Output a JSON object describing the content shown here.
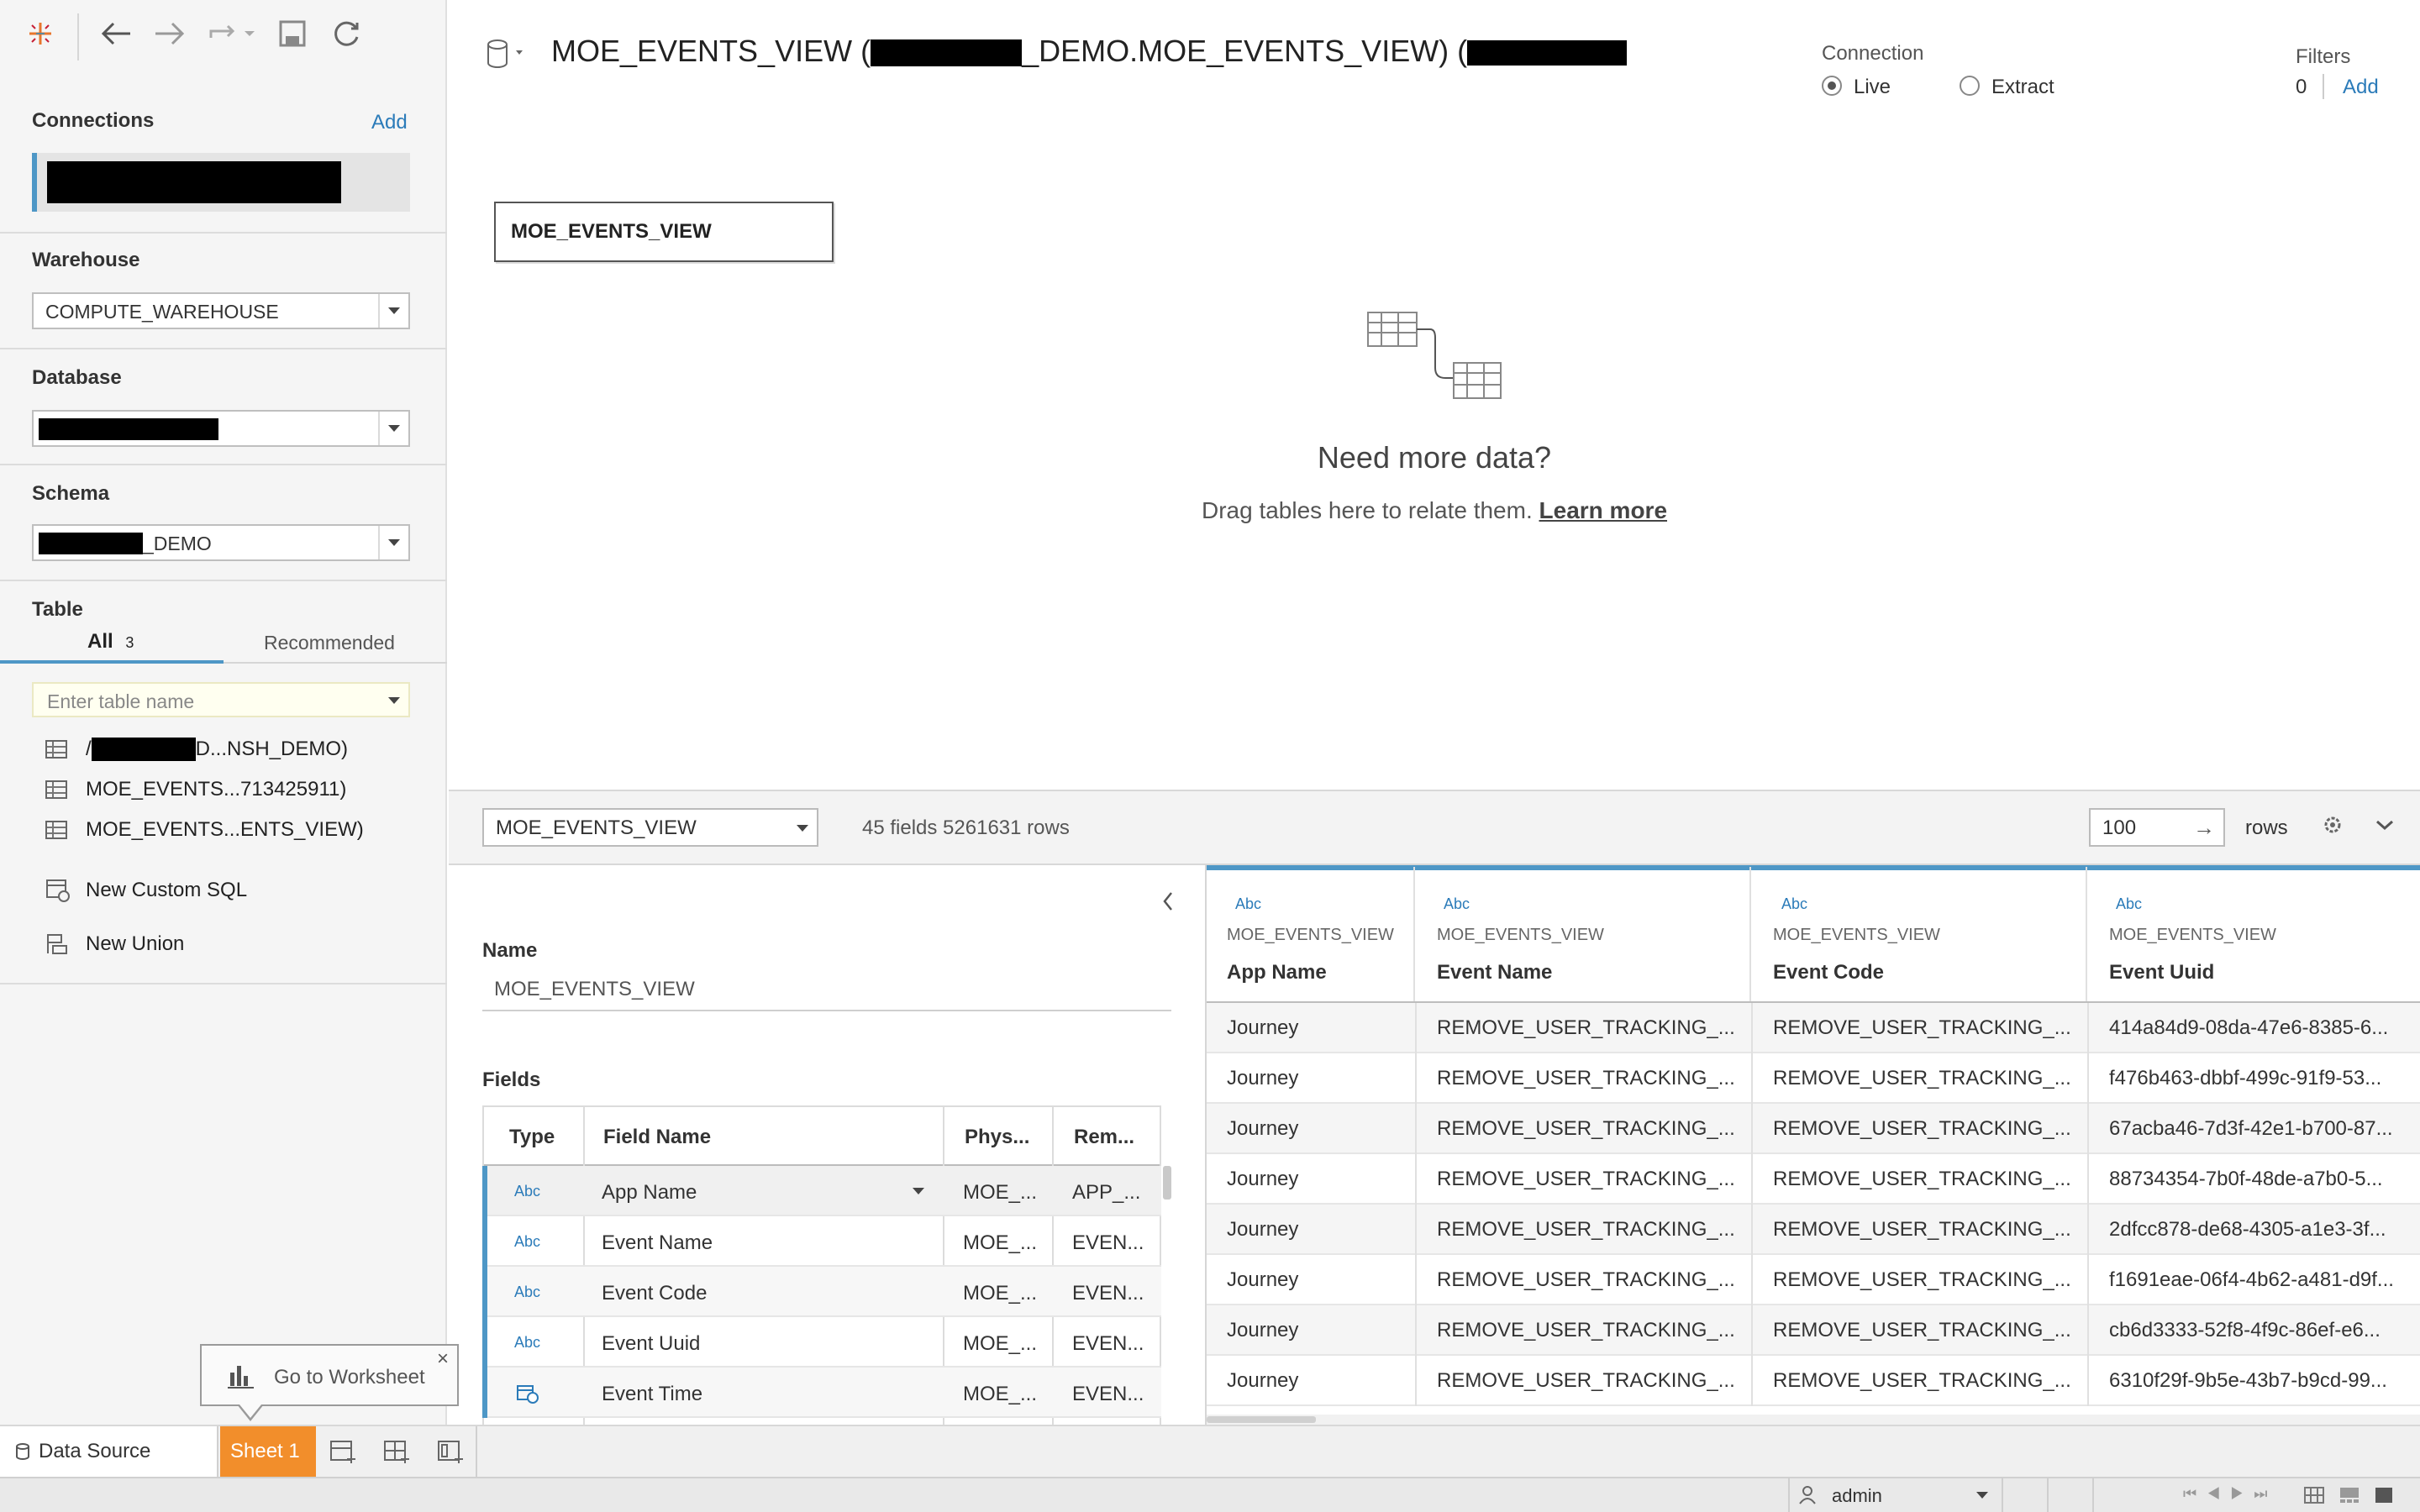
{
  "toolbar": {
    "icons": [
      "tableau-logo-icon",
      "back-arrow-icon",
      "forward-arrow-icon",
      "redo-icon",
      "save-icon",
      "refresh-icon"
    ]
  },
  "sidebar": {
    "connections": {
      "heading": "Connections",
      "add_label": "Add"
    },
    "warehouse": {
      "heading": "Warehouse",
      "value": "COMPUTE_WAREHOUSE"
    },
    "database": {
      "heading": "Database"
    },
    "schema": {
      "heading": "Schema",
      "value_suffix": "_DEMO"
    },
    "table": {
      "heading": "Table",
      "tab_all": "All",
      "tab_all_count": "3",
      "tab_recommended": "Recommended",
      "search_placeholder": "Enter table name",
      "items": [
        {
          "label": "D...NSH_DEMO)",
          "prefix": "/"
        },
        {
          "label": "MOE_EVENTS...713425911)"
        },
        {
          "label": "MOE_EVENTS...ENTS_VIEW)"
        }
      ],
      "new_custom_sql": "New Custom SQL",
      "new_union": "New Union"
    }
  },
  "canvas": {
    "title_part1": "MOE_EVENTS_VIEW (",
    "title_part2": "_DEMO.MOE_EVENTS_VIEW) (",
    "connection": {
      "label": "Connection",
      "live": "Live",
      "extract": "Extract",
      "selected": "Live"
    },
    "filters": {
      "label": "Filters",
      "count": "0",
      "add": "Add"
    },
    "table_box": "MOE_EVENTS_VIEW",
    "empty_title": "Need more data?",
    "empty_text": "Drag tables here to relate them.",
    "learn_more": "Learn more"
  },
  "data_toolbar": {
    "table_select": "MOE_EVENTS_VIEW",
    "summary": "45 fields 5261631 rows",
    "rows_value": "100",
    "rows_label": "rows"
  },
  "metadata": {
    "name_label": "Name",
    "name_value": "MOE_EVENTS_VIEW",
    "fields_label": "Fields",
    "columns": [
      "Type",
      "Field Name",
      "Phys...",
      "Rem..."
    ],
    "rows": [
      {
        "type": "Abc",
        "field": "App Name",
        "phys": "MOE_...",
        "rem": "APP_..."
      },
      {
        "type": "Abc",
        "field": "Event Name",
        "phys": "MOE_...",
        "rem": "EVEN..."
      },
      {
        "type": "Abc",
        "field": "Event Code",
        "phys": "MOE_...",
        "rem": "EVEN..."
      },
      {
        "type": "Abc",
        "field": "Event Uuid",
        "phys": "MOE_...",
        "rem": "EVEN..."
      },
      {
        "type": "date",
        "field": "Event Time",
        "phys": "MOE_...",
        "rem": "EVEN..."
      }
    ]
  },
  "grid": {
    "columns": [
      {
        "type": "Abc",
        "source": "MOE_EVENTS_VIEW",
        "name": "App Name"
      },
      {
        "type": "Abc",
        "source": "MOE_EVENTS_VIEW",
        "name": "Event Name"
      },
      {
        "type": "Abc",
        "source": "MOE_EVENTS_VIEW",
        "name": "Event Code"
      },
      {
        "type": "Abc",
        "source": "MOE_EVENTS_VIEW",
        "name": "Event Uuid"
      }
    ],
    "rows": [
      [
        "Journey",
        "REMOVE_USER_TRACKING_...",
        "REMOVE_USER_TRACKING_...",
        "414a84d9-08da-47e6-8385-6..."
      ],
      [
        "Journey",
        "REMOVE_USER_TRACKING_...",
        "REMOVE_USER_TRACKING_...",
        "f476b463-dbbf-499c-91f9-53..."
      ],
      [
        "Journey",
        "REMOVE_USER_TRACKING_...",
        "REMOVE_USER_TRACKING_...",
        "67acba46-7d3f-42e1-b700-87..."
      ],
      [
        "Journey",
        "REMOVE_USER_TRACKING_...",
        "REMOVE_USER_TRACKING_...",
        "88734354-7b0f-48de-a7b0-5..."
      ],
      [
        "Journey",
        "REMOVE_USER_TRACKING_...",
        "REMOVE_USER_TRACKING_...",
        "2dfcc878-de68-4305-a1e3-3f..."
      ],
      [
        "Journey",
        "REMOVE_USER_TRACKING_...",
        "REMOVE_USER_TRACKING_...",
        "f1691eae-06f4-4b62-a481-d9f..."
      ],
      [
        "Journey",
        "REMOVE_USER_TRACKING_...",
        "REMOVE_USER_TRACKING_...",
        "cb6d3333-52f8-4f9c-86ef-e6..."
      ],
      [
        "Journey",
        "REMOVE_USER_TRACKING_...",
        "REMOVE_USER_TRACKING_...",
        "6310f29f-9b5e-43b7-b9cd-99..."
      ]
    ]
  },
  "tooltip": {
    "text": "Go to Worksheet"
  },
  "tabs": {
    "data_source": "Data Source",
    "sheet1": "Sheet 1"
  },
  "status": {
    "user": "admin"
  },
  "colors": {
    "accent": "#2b7bb9",
    "tab_active": "#f28e2b",
    "grid_header_bar": "#4e97c6"
  }
}
